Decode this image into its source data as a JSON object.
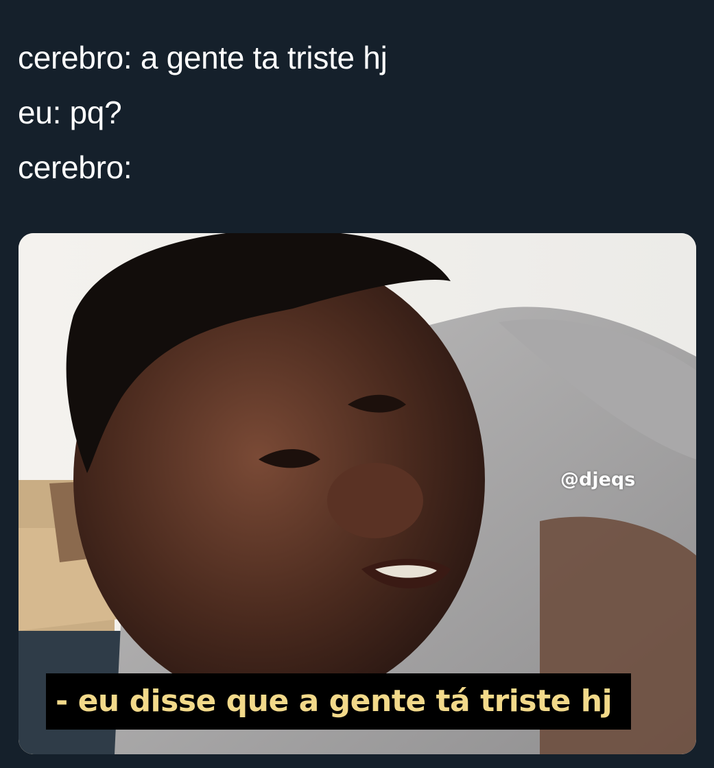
{
  "post": {
    "text_lines": [
      "cerebro: a gente ta triste hj",
      "eu: pq?",
      "cerebro:"
    ]
  },
  "media": {
    "watermark": "@djeqs",
    "subtitle": "- eu disse que a gente tá triste hj"
  },
  "colors": {
    "background": "#15202b",
    "text": "#ffffff",
    "subtitle_text": "#f2d98a",
    "subtitle_bg": "#000000"
  }
}
